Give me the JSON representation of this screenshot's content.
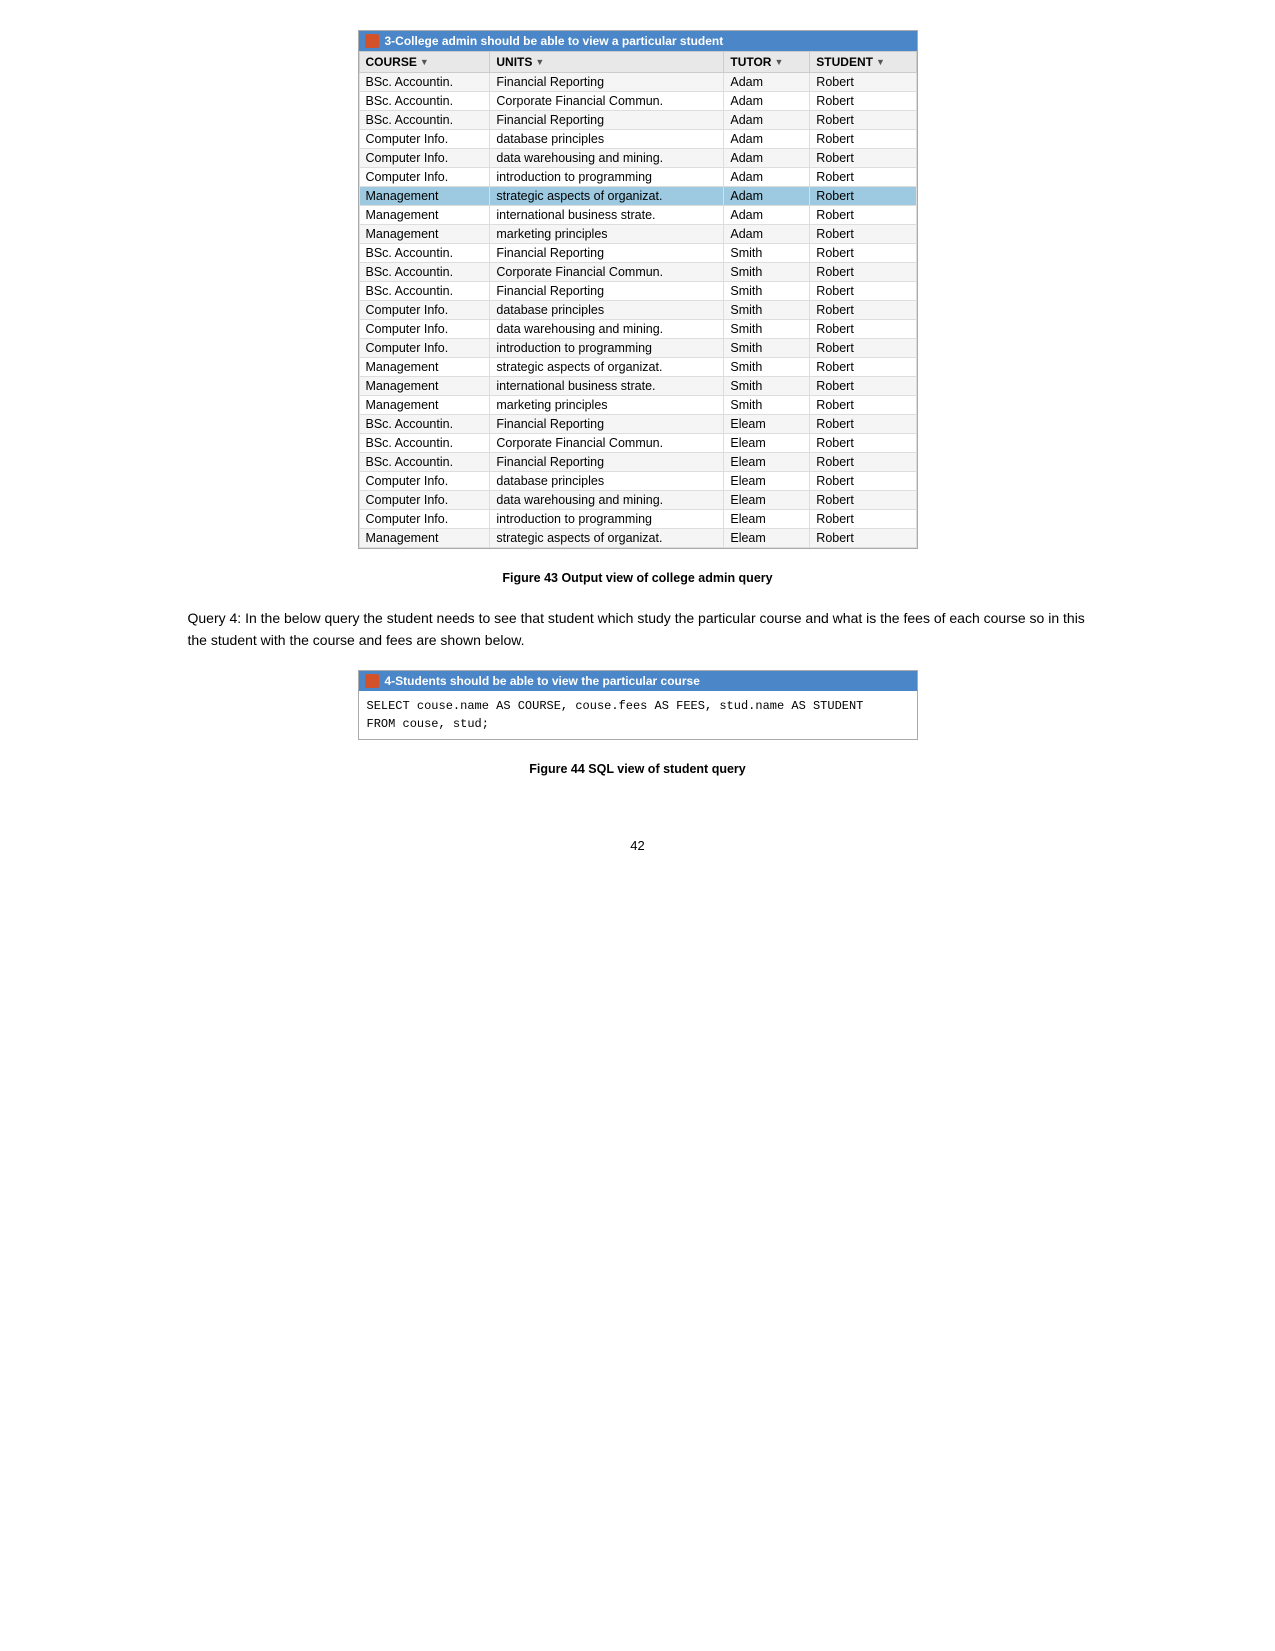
{
  "table1": {
    "titlebar": "3-College admin should be able to view a particular student",
    "columns": [
      {
        "label": "COURSE",
        "sortable": true
      },
      {
        "label": "UNITS",
        "sortable": true
      },
      {
        "label": "TUTOR",
        "sortable": true
      },
      {
        "label": "STUDENT",
        "sortable": true
      }
    ],
    "rows": [
      {
        "course": "BSc. Accountin.",
        "units": "Financial Reporting",
        "tutor": "Adam",
        "student": "Robert",
        "highlight": false
      },
      {
        "course": "BSc. Accountin.",
        "units": "Corporate Financial Commun.",
        "tutor": "Adam",
        "student": "Robert",
        "highlight": false
      },
      {
        "course": "BSc. Accountin.",
        "units": "Financial Reporting",
        "tutor": "Adam",
        "student": "Robert",
        "highlight": false
      },
      {
        "course": "Computer Info.",
        "units": "database principles",
        "tutor": "Adam",
        "student": "Robert",
        "highlight": false
      },
      {
        "course": "Computer Info.",
        "units": "data warehousing and mining.",
        "tutor": "Adam",
        "student": "Robert",
        "highlight": false
      },
      {
        "course": "Computer Info.",
        "units": "introduction to programming",
        "tutor": "Adam",
        "student": "Robert",
        "highlight": false
      },
      {
        "course": "Management",
        "units": "strategic aspects of organizat.",
        "tutor": "Adam",
        "student": "Robert",
        "highlight": true
      },
      {
        "course": "Management",
        "units": "international business strate.",
        "tutor": "Adam",
        "student": "Robert",
        "highlight": false
      },
      {
        "course": "Management",
        "units": "marketing principles",
        "tutor": "Adam",
        "student": "Robert",
        "highlight": false
      },
      {
        "course": "BSc. Accountin.",
        "units": "Financial Reporting",
        "tutor": "Smith",
        "student": "Robert",
        "highlight": false
      },
      {
        "course": "BSc. Accountin.",
        "units": "Corporate Financial Commun.",
        "tutor": "Smith",
        "student": "Robert",
        "highlight": false
      },
      {
        "course": "BSc. Accountin.",
        "units": "Financial Reporting",
        "tutor": "Smith",
        "student": "Robert",
        "highlight": false
      },
      {
        "course": "Computer Info.",
        "units": "database principles",
        "tutor": "Smith",
        "student": "Robert",
        "highlight": false
      },
      {
        "course": "Computer Info.",
        "units": "data warehousing and mining.",
        "tutor": "Smith",
        "student": "Robert",
        "highlight": false
      },
      {
        "course": "Computer Info.",
        "units": "introduction to programming",
        "tutor": "Smith",
        "student": "Robert",
        "highlight": false
      },
      {
        "course": "Management",
        "units": "strategic aspects of organizat.",
        "tutor": "Smith",
        "student": "Robert",
        "highlight": false
      },
      {
        "course": "Management",
        "units": "international business strate.",
        "tutor": "Smith",
        "student": "Robert",
        "highlight": false
      },
      {
        "course": "Management",
        "units": "marketing principles",
        "tutor": "Smith",
        "student": "Robert",
        "highlight": false
      },
      {
        "course": "BSc. Accountin.",
        "units": "Financial Reporting",
        "tutor": "Eleam",
        "student": "Robert",
        "highlight": false
      },
      {
        "course": "BSc. Accountin.",
        "units": "Corporate Financial Commun.",
        "tutor": "Eleam",
        "student": "Robert",
        "highlight": false
      },
      {
        "course": "BSc. Accountin.",
        "units": "Financial Reporting",
        "tutor": "Eleam",
        "student": "Robert",
        "highlight": false
      },
      {
        "course": "Computer Info.",
        "units": "database principles",
        "tutor": "Eleam",
        "student": "Robert",
        "highlight": false
      },
      {
        "course": "Computer Info.",
        "units": "data warehousing and mining.",
        "tutor": "Eleam",
        "student": "Robert",
        "highlight": false
      },
      {
        "course": "Computer Info.",
        "units": "introduction to programming",
        "tutor": "Eleam",
        "student": "Robert",
        "highlight": false
      },
      {
        "course": "Management",
        "units": "strategic aspects of organizat.",
        "tutor": "Eleam",
        "student": "Robert",
        "highlight": false
      }
    ],
    "caption": "Figure 43 Output view of college admin query"
  },
  "body_text": "Query 4: In the below query the student needs to see that student which study the particular course and what is the fees of each course so in this the student with the course and fees are shown below.",
  "table2": {
    "titlebar": "4-Students should be able to view the particular course",
    "sql": "SELECT couse.name AS COURSE, couse.fees AS FEES, stud.name AS STUDENT\nFROM couse, stud;",
    "caption": "Figure 44 SQL view of student query"
  },
  "page_number": "42"
}
